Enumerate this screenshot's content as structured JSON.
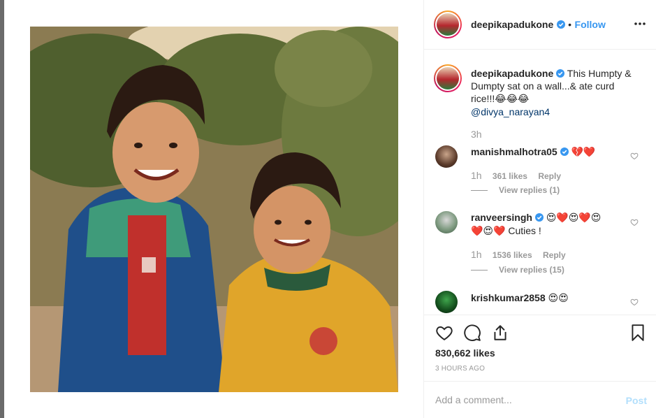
{
  "post": {
    "author": "deepikapadukone",
    "follow_label": "Follow",
    "separator": "•",
    "photo_alt": "Vintage photo of two smiling children outdoors"
  },
  "caption": {
    "author": "deepikapadukone",
    "text": "This Humpty & Dumpty sat on a wall...& ate curd rice!!!",
    "emojis": "😂😂😂",
    "mention": "@divya_narayan4",
    "time": "3h"
  },
  "comments": [
    {
      "author": "manishmalhotra05",
      "text": "",
      "emojis": "💔❤️",
      "time": "1h",
      "likes": "361 likes",
      "reply_label": "Reply",
      "view_replies": "View replies (1)"
    },
    {
      "author": "ranveersingh",
      "emojis_line1": "😍❤️😍❤️😍",
      "emojis_line2": "❤️😍❤️",
      "text": " Cuties !",
      "time": "1h",
      "likes": "1536 likes",
      "reply_label": "Reply",
      "view_replies": "View replies (15)"
    },
    {
      "author": "krishkumar2858",
      "emojis": "😍😍"
    }
  ],
  "stats": {
    "likes": "830,662 likes",
    "time_ago": "3 HOURS AGO"
  },
  "add_comment": {
    "placeholder": "Add a comment...",
    "post_label": "Post"
  },
  "colors": {
    "accent": "#3897f0",
    "text": "#262626",
    "muted": "#999999",
    "border": "#efefef",
    "post_disabled": "#b2dffc"
  },
  "icons": [
    "more-options-icon",
    "verified-badge-icon",
    "heart-icon",
    "comment-icon",
    "share-icon",
    "bookmark-icon"
  ]
}
